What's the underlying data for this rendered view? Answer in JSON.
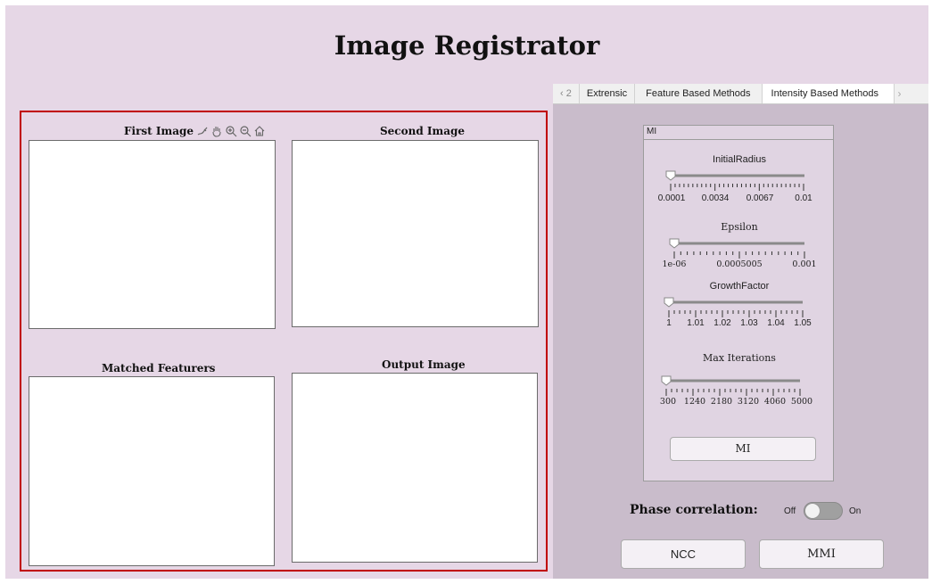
{
  "app": {
    "title": "Image Registrator"
  },
  "axes": {
    "first": {
      "title": "First Image"
    },
    "second": {
      "title": "Second Image"
    },
    "matched": {
      "title": "Matched Featurers"
    },
    "output": {
      "title": "Output Image"
    },
    "toolbar_icons": [
      "brush-icon",
      "pan-icon",
      "zoom-in-icon",
      "zoom-out-icon",
      "home-icon"
    ]
  },
  "tabs": {
    "scroll_left": "2",
    "items": [
      {
        "label": "Extrensic"
      },
      {
        "label": "Feature Based Methods"
      },
      {
        "label": "Intensity Based Methods"
      }
    ],
    "active_index": 2
  },
  "mi_panel": {
    "title": "MI",
    "sliders": [
      {
        "label": "InitialRadius",
        "ticks": [
          "0.0001",
          "0.0034",
          "0.0067",
          "0.01"
        ],
        "value": "0.0001"
      },
      {
        "label": "Epsilon",
        "ticks": [
          "1e-06",
          "0.0005005",
          "0.001"
        ],
        "value": "1e-06"
      },
      {
        "label": "GrowthFactor",
        "ticks": [
          "1",
          "1.01",
          "1.02",
          "1.03",
          "1.04",
          "1.05"
        ],
        "value": "1"
      },
      {
        "label": "Max Iterations",
        "ticks": [
          "300",
          "1240",
          "2180",
          "3120",
          "4060",
          "5000"
        ],
        "value": "300"
      }
    ],
    "button_label": "MI"
  },
  "phase": {
    "label": "Phase correlation:",
    "off_label": "Off",
    "on_label": "On",
    "state": "Off"
  },
  "buttons": {
    "ncc": "NCC",
    "mmi": "MMI"
  },
  "colors": {
    "background": "#e6d7e6",
    "panel_border": "#c00000",
    "tab_panel": "#c9bccb"
  }
}
